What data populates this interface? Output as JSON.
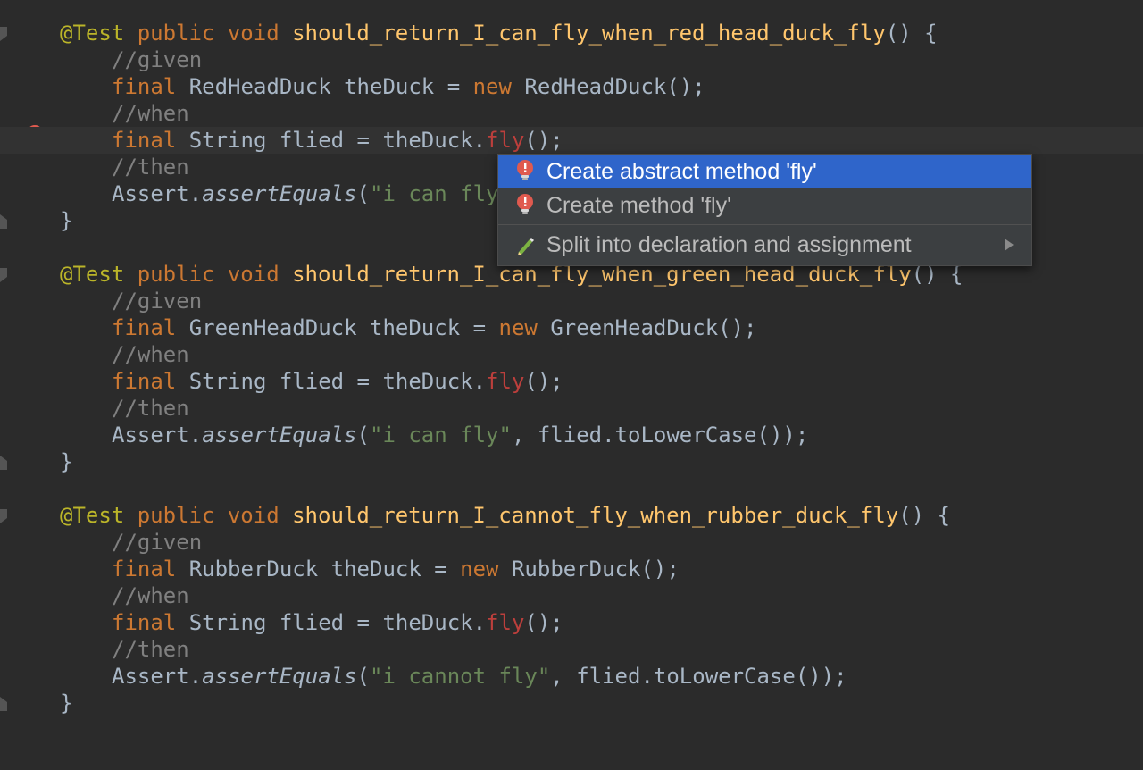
{
  "methods": [
    {
      "annotation": "@Test",
      "kw_public": "public",
      "kw_void": "void",
      "name": "should_return_I_can_fly_when_red_head_duck_fly",
      "sig_tail": "() {",
      "given_comment": "//given",
      "kw_final1": "final",
      "decl_type": "RedHeadDuck",
      "decl_var": "theDuck =",
      "kw_new": "new",
      "ctor": "RedHeadDuck();",
      "when_comment": "//when",
      "kw_final2": "final",
      "call_prefix": "String flied = theDuck.",
      "call_method": "fly",
      "call_suffix": "();",
      "then_comment": "//then",
      "assert_obj": "Assert.",
      "assert_method": "assertEquals",
      "assert_open": "(",
      "assert_string": "\"i can fly\"",
      "assert_rest": "",
      "close_brace": "}"
    },
    {
      "annotation": "@Test",
      "kw_public": "public",
      "kw_void": "void",
      "name": "should_return_I_can_fly_when_green_head_duck_fly",
      "sig_tail": "() {",
      "given_comment": "//given",
      "kw_final1": "final",
      "decl_type": "GreenHeadDuck",
      "decl_var": "theDuck =",
      "kw_new": "new",
      "ctor": "GreenHeadDuck();",
      "when_comment": "//when",
      "kw_final2": "final",
      "call_prefix": "String flied = theDuck.",
      "call_method": "fly",
      "call_suffix": "();",
      "then_comment": "//then",
      "assert_obj": "Assert.",
      "assert_method": "assertEquals",
      "assert_open": "(",
      "assert_string": "\"i can fly\"",
      "assert_rest": ", flied.toLowerCase());",
      "close_brace": "}"
    },
    {
      "annotation": "@Test",
      "kw_public": "public",
      "kw_void": "void",
      "name": "should_return_I_cannot_fly_when_rubber_duck_fly",
      "sig_tail": "() {",
      "given_comment": "//given",
      "kw_final1": "final",
      "decl_type": "RubberDuck",
      "decl_var": "theDuck =",
      "kw_new": "new",
      "ctor": "RubberDuck();",
      "when_comment": "//when",
      "kw_final2": "final",
      "call_prefix": "String flied = theDuck.",
      "call_method": "fly",
      "call_suffix": "();",
      "then_comment": "//then",
      "assert_obj": "Assert.",
      "assert_method": "assertEquals",
      "assert_open": "(",
      "assert_string": "\"i cannot fly\"",
      "assert_rest": ", flied.toLowerCase());",
      "close_brace": "}"
    }
  ],
  "intention_popup": {
    "items": [
      {
        "label": "Create abstract method 'fly'",
        "icon": "error-bulb-icon",
        "selected": true
      },
      {
        "label": "Create method 'fly'",
        "icon": "error-bulb-icon",
        "selected": false
      },
      {
        "label": "Split into declaration and assignment",
        "icon": "pencil-icon",
        "selected": false,
        "has_submenu": true
      }
    ]
  },
  "colors": {
    "background": "#2b2b2b",
    "current_line": "#323232",
    "keyword": "#cc7832",
    "annotation": "#bbb529",
    "method_name": "#ffc66d",
    "comment": "#808080",
    "string": "#6a8759",
    "error": "#bc3f3c",
    "popup_bg": "#3c3f41",
    "popup_selected": "#2f65ca"
  }
}
